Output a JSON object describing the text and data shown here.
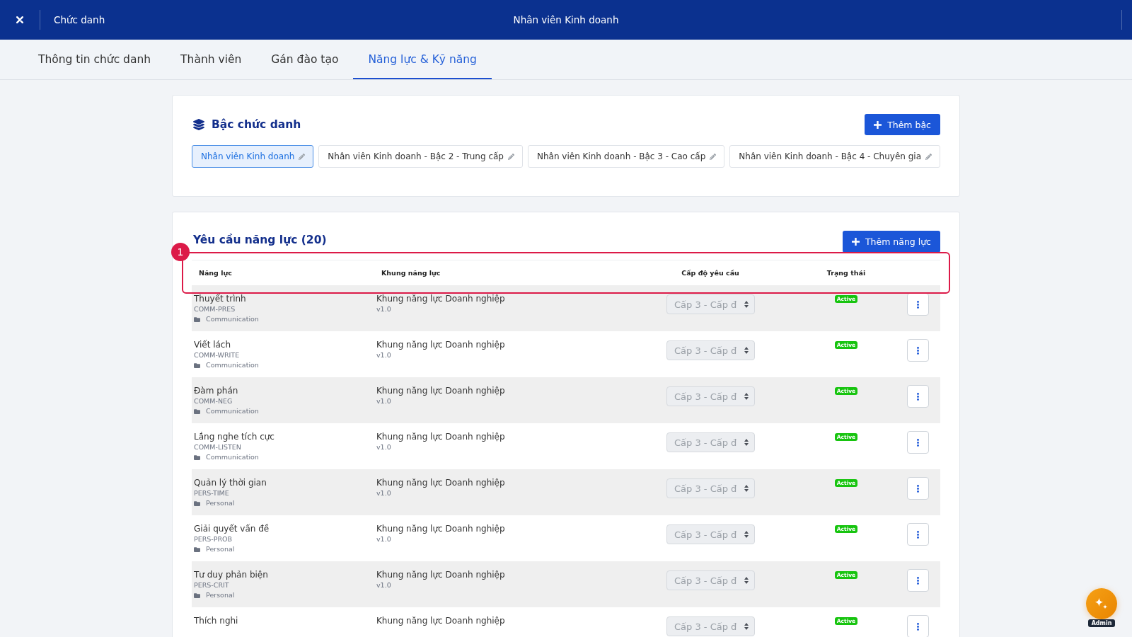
{
  "top_bar": {
    "breadcrumb": "Chức danh",
    "title": "Nhân viên Kinh doanh"
  },
  "tabs": [
    {
      "label": "Thông tin chức danh",
      "selected": false
    },
    {
      "label": "Thành viên",
      "selected": false
    },
    {
      "label": "Gán đào tạo",
      "selected": false
    },
    {
      "label": "Năng lực & Kỹ năng",
      "selected": true
    }
  ],
  "level_card": {
    "title": "Bậc chức danh",
    "add_button": "Thêm bậc",
    "levels": [
      {
        "label": "Nhân viên Kinh doanh",
        "selected": true
      },
      {
        "label": "Nhân viên Kinh doanh - Bậc 2 - Trung cấp",
        "selected": false
      },
      {
        "label": "Nhân viên Kinh doanh - Bậc 3 - Cao cấp",
        "selected": false
      },
      {
        "label": "Nhân viên Kinh doanh - Bậc 4 - Chuyên gia",
        "selected": false
      }
    ]
  },
  "requirement_card": {
    "title": "Yêu cầu năng lực (20)",
    "add_button": "Thêm năng lực",
    "highlight": {
      "badge": "1"
    },
    "columns": [
      "Năng lực",
      "Khung năng lực",
      "Cấp độ yêu cầu",
      "Trạng thái"
    ],
    "rows": [
      {
        "name": "Thuyết trình",
        "code": "COMM-PRES",
        "category": "Communication",
        "framework": "Khung năng lực Doanh nghiệp",
        "version": "v1.0",
        "required_level": {
          "value": "Cấp 3 - Cấp đ",
          "disabled": true
        },
        "status": "Active"
      },
      {
        "name": "Viết lách",
        "code": "COMM-WRITE",
        "category": "Communication",
        "framework": "Khung năng lực Doanh nghiệp",
        "version": "v1.0",
        "required_level": {
          "value": "Cấp 3 - Cấp đ",
          "disabled": true
        },
        "status": "Active"
      },
      {
        "name": "Đàm phán",
        "code": "COMM-NEG",
        "category": "Communication",
        "framework": "Khung năng lực Doanh nghiệp",
        "version": "v1.0",
        "required_level": {
          "value": "Cấp 3 - Cấp đ",
          "disabled": true
        },
        "status": "Active"
      },
      {
        "name": "Lắng nghe tích cực",
        "code": "COMM-LISTEN",
        "category": "Communication",
        "framework": "Khung năng lực Doanh nghiệp",
        "version": "v1.0",
        "required_level": {
          "value": "Cấp 3 - Cấp đ",
          "disabled": true
        },
        "status": "Active"
      },
      {
        "name": "Quản lý thời gian",
        "code": "PERS-TIME",
        "category": "Personal",
        "framework": "Khung năng lực Doanh nghiệp",
        "version": "v1.0",
        "required_level": {
          "value": "Cấp 3 - Cấp đ",
          "disabled": true
        },
        "status": "Active"
      },
      {
        "name": "Giải quyết vấn đề",
        "code": "PERS-PROB",
        "category": "Personal",
        "framework": "Khung năng lực Doanh nghiệp",
        "version": "v1.0",
        "required_level": {
          "value": "Cấp 3 - Cấp đ",
          "disabled": true
        },
        "status": "Active"
      },
      {
        "name": "Tư duy phản biện",
        "code": "PERS-CRIT",
        "category": "Personal",
        "framework": "Khung năng lực Doanh nghiệp",
        "version": "v1.0",
        "required_level": {
          "value": "Cấp 3 - Cấp đ",
          "disabled": true
        },
        "status": "Active"
      },
      {
        "name": "Thích nghi",
        "framework": "Khung năng lực Doanh nghiệp",
        "required_level": {
          "value": "Cấp 3 - Cấp đ",
          "disabled": true
        },
        "status": "Active"
      }
    ]
  },
  "assistant": {
    "label": "Admin"
  }
}
